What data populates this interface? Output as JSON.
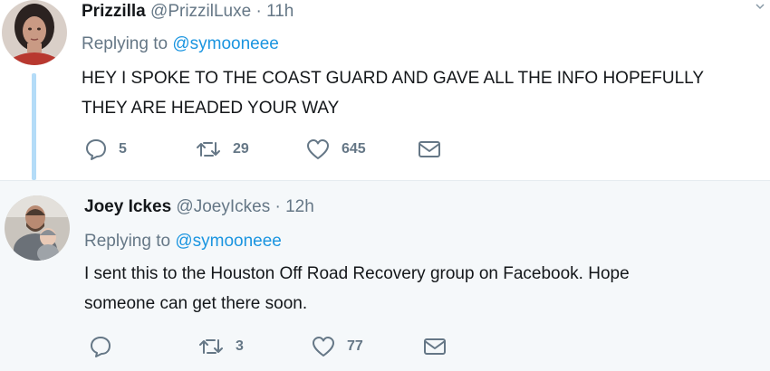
{
  "tweets": [
    {
      "name": "Prizzilla",
      "handle": "@PrizzilLuxe",
      "time": "11h",
      "replying_prefix": "Replying to",
      "replying_to": "@symooneee",
      "text": "HEY I SPOKE TO THE COAST GUARD AND GAVE ALL THE INFO HOPEFULLY\nTHEY ARE HEADED YOUR WAY",
      "replies": "5",
      "retweets": "29",
      "likes": "645"
    },
    {
      "name": "Joey Ickes",
      "handle": "@JoeyIckes",
      "time": "12h",
      "replying_prefix": "Replying to",
      "replying_to": "@symooneee",
      "text": "I sent this to the Houston Off Road Recovery group on Facebook. Hope\nsomeone can get there soon.",
      "replies": "",
      "retweets": "3",
      "likes": "77"
    }
  ],
  "separator": "·",
  "icons": {
    "reply": "reply-icon",
    "retweet": "retweet-icon",
    "like": "heart-icon",
    "dm": "envelope-icon",
    "more": "chevron-down-icon"
  },
  "colors": {
    "link": "#1b95e0",
    "secondary": "#657786",
    "thread_line": "#b4dcf8",
    "reply_bg": "#f5f8fa"
  }
}
